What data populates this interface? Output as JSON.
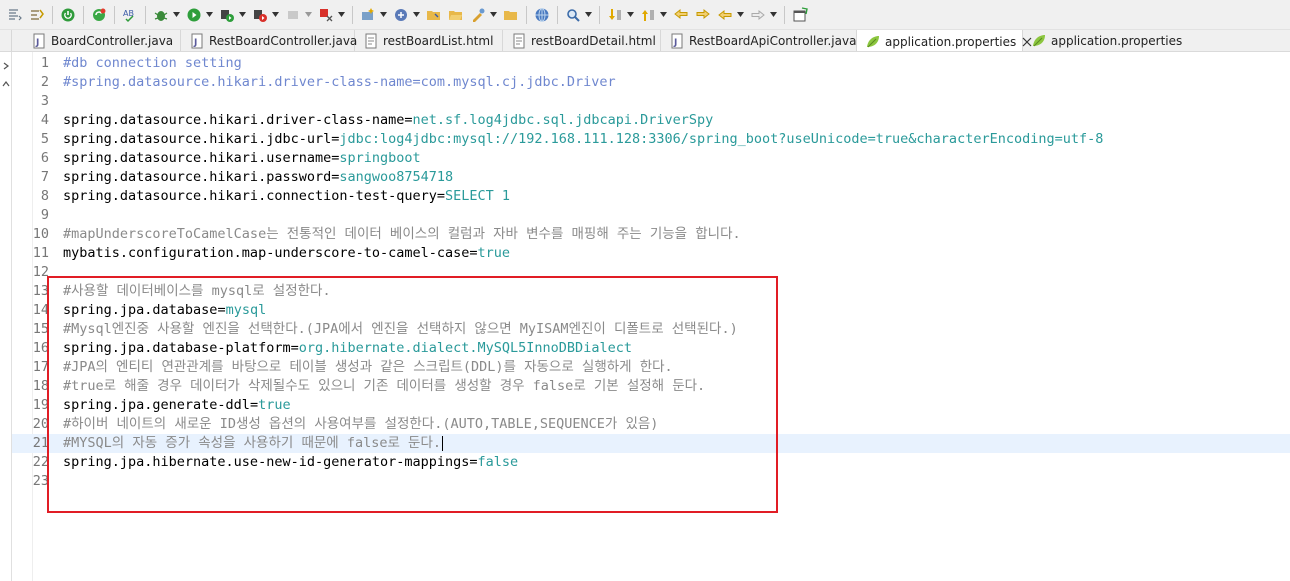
{
  "tabs": [
    {
      "label": "BoardController.java",
      "icon": "java-file-icon",
      "active": false
    },
    {
      "label": "RestBoardController.java",
      "icon": "java-file-icon",
      "active": false
    },
    {
      "label": "restBoardList.html",
      "icon": "html-file-icon",
      "active": false
    },
    {
      "label": "restBoardDetail.html",
      "icon": "html-file-icon",
      "active": false
    },
    {
      "label": "RestBoardApiController.java",
      "icon": "java-file-icon",
      "active": false
    },
    {
      "label": "application.properties",
      "icon": "properties-file-icon",
      "active": true,
      "closable": true
    },
    {
      "label": "application.properties",
      "icon": "properties-file-icon",
      "active": false
    }
  ],
  "editor": {
    "current_line": 21,
    "lines": [
      {
        "n": "1",
        "type": "comment",
        "text": "#db connection setting"
      },
      {
        "n": "2",
        "type": "comment",
        "text": "#spring.datasource.hikari.driver-class-name=com.mysql.cj.jdbc.Driver"
      },
      {
        "n": "3",
        "type": "blank",
        "text": ""
      },
      {
        "n": "4",
        "type": "prop",
        "key": "spring.datasource.hikari.driver-class-name",
        "eq": "=",
        "val": "net.sf.log4jdbc.sql.jdbcapi.DriverSpy"
      },
      {
        "n": "5",
        "type": "prop",
        "key": "spring.datasource.hikari.jdbc-url",
        "eq": "=",
        "val": "jdbc:log4jdbc:mysql://192.168.111.128:3306/spring_boot?useUnicode=true&characterEncoding=utf-8"
      },
      {
        "n": "6",
        "type": "prop",
        "key": "spring.datasource.hikari.username",
        "eq": "=",
        "val": "springboot"
      },
      {
        "n": "7",
        "type": "prop",
        "key": "spring.datasource.hikari.password",
        "eq": "=",
        "val": "sangwoo8754718"
      },
      {
        "n": "8",
        "type": "prop",
        "key": "spring.datasource.hikari.connection-test-query",
        "eq": "=",
        "val": "SELECT 1"
      },
      {
        "n": "9",
        "type": "blank",
        "text": ""
      },
      {
        "n": "10",
        "type": "comment",
        "text": "#mapUnderscoreToCamelCase는 전통적인 데이터 베이스의 컬럼과 자바 변수를 매핑해 주는 기능을 합니다."
      },
      {
        "n": "11",
        "type": "prop",
        "key": "mybatis.configuration.map-underscore-to-camel-case",
        "eq": "=",
        "val": "true"
      },
      {
        "n": "12",
        "type": "blank",
        "text": ""
      },
      {
        "n": "13",
        "type": "comment",
        "text": "#사용할 데이터베이스를 mysql로 설정한다."
      },
      {
        "n": "14",
        "type": "prop",
        "key": "spring.jpa.database",
        "eq": "=",
        "val": "mysql"
      },
      {
        "n": "15",
        "type": "comment",
        "text": "#Mysql엔진중 사용할 엔진을 선택한다.(JPA에서 엔진을 선택하지 않으면 MyISAM엔진이 디폴트로 선택된다.)"
      },
      {
        "n": "16",
        "type": "prop",
        "key": "spring.jpa.database-platform",
        "eq": "=",
        "val": "org.hibernate.dialect.MySQL5InnoDBDialect"
      },
      {
        "n": "17",
        "type": "comment",
        "text": "#JPA의 엔티티 연관관계를 바탕으로 테이블 생성과 같은 스크립트(DDL)를 자동으로 실행하게 한다."
      },
      {
        "n": "18",
        "type": "comment",
        "text": "#true로 해줄 경우 데이터가 삭제될수도 있으니 기존 데이터를 생성할 경우 false로 기본 설정해 둔다."
      },
      {
        "n": "19",
        "type": "prop",
        "key": "spring.jpa.generate-ddl",
        "eq": "=",
        "val": "true"
      },
      {
        "n": "20",
        "type": "comment",
        "text": "#하이버 네이트의 새로운 ID생성 옵션의 사용여부를 설정한다.(AUTO,TABLE,SEQUENCE가 있음)"
      },
      {
        "n": "21",
        "type": "comment",
        "text": "#MYSQL의 자동 증가 속성을 사용하기 때문에 false로 둔다."
      },
      {
        "n": "22",
        "type": "prop",
        "key": "spring.jpa.hibernate.use-new-id-generator-mappings",
        "eq": "=",
        "val": "false"
      },
      {
        "n": "23",
        "type": "blank",
        "text": ""
      }
    ]
  },
  "colors": {
    "highlight_box": "#e11d25",
    "value_text": "#2a9a9a",
    "comment_text": "#3f5fbf",
    "current_line_bg": "#e8f2fe"
  }
}
